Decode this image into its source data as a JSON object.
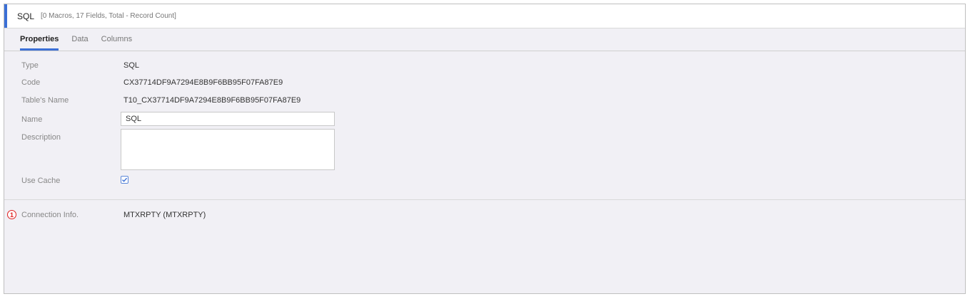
{
  "header": {
    "title": "SQL",
    "subtitle": "[0 Macros, 17 Fields, Total - Record Count]"
  },
  "tabs": [
    {
      "label": "Properties",
      "active": true
    },
    {
      "label": "Data",
      "active": false
    },
    {
      "label": "Columns",
      "active": false
    }
  ],
  "properties": {
    "type_label": "Type",
    "type_value": "SQL",
    "code_label": "Code",
    "code_value": "CX37714DF9A7294E8B9F6BB95F07FA87E9",
    "table_label": "Table's Name",
    "table_value": "T10_CX37714DF9A7294E8B9F6BB95F07FA87E9",
    "name_label": "Name",
    "name_value": "SQL",
    "description_label": "Description",
    "description_value": "",
    "use_cache_label": "Use Cache",
    "use_cache_checked": true
  },
  "connection": {
    "marker": "1",
    "label": "Connection Info.",
    "value": "MTXRPTY (MTXRPTY)"
  },
  "colors": {
    "accent": "#3b6fd6",
    "marker": "#e02020",
    "panel_bg": "#f1f0f5"
  }
}
